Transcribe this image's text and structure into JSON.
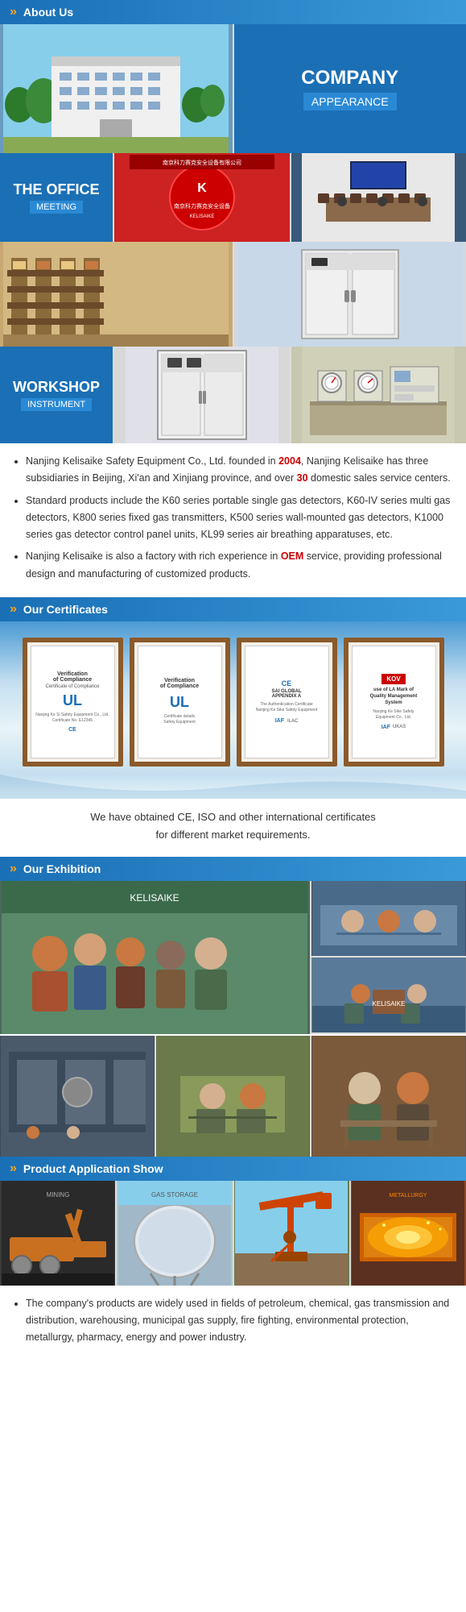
{
  "header": {
    "title": "About Us",
    "chevron": "»"
  },
  "sections": {
    "company_appearance": {
      "line1": "COMPANY",
      "line2": "APPEARANCE"
    },
    "office_meeting": {
      "line1": "THE OFFICE",
      "line2": "MEETING"
    },
    "workshop": {
      "line1": "WORKSHOP",
      "line2": "INSTRUMENT"
    }
  },
  "description": {
    "bullet1": "Nanjing Kelisaike Safety Equipment Co., Ltd. founded in 2004, Nanjing Kelisaike has three subsidiaries in Beijing, Xi'an and Xinjiang province, and over 30 domestic sales service centers.",
    "bullet1_highlight1": "2004",
    "bullet1_highlight2": "30",
    "bullet2": "Standard products include the K60 series portable single gas detectors, K60-IV series multi gas detectors, K800 series fixed gas transmitters, K500 series wall-mounted gas detectors, K1000 series gas detector control panel units, KL99 series air breathing apparatuses, etc.",
    "bullet3": "Nanjing Kelisaike is also a factory with rich experience in OEM service, providing professional design and manufacturing of customized products.",
    "bullet3_highlight": "OEM"
  },
  "certificates_section": {
    "header": "Our Certificates",
    "cert1_title": "Verification of Compliance",
    "cert1_logo": "UL",
    "cert2_title": "Verification of Compliance",
    "cert2_logo": "UL",
    "cert3_title": "CE SAI GLOBAL",
    "cert3_logo": "CE",
    "cert4_title": "The Authentication Certificate of Quality Management System",
    "cert4_logo": "IAF",
    "cert4_badge": "LA Mark",
    "caption": "We have obtained CE, ISO and other international certificates\nfor different market requirements.",
    "caption_highlight1": "CE",
    "caption_highlight2": "ISO"
  },
  "exhibition_section": {
    "header": "Our Exhibition"
  },
  "product_section": {
    "header": "Product Application Show"
  },
  "bottom_description": {
    "bullet1": "The company's products are widely used in fields of petroleum, chemical, gas transmission and distribution, warehousing, municipal gas supply, fire fighting, environmental protection, metallurgy, pharmacy, energy and power industry."
  }
}
